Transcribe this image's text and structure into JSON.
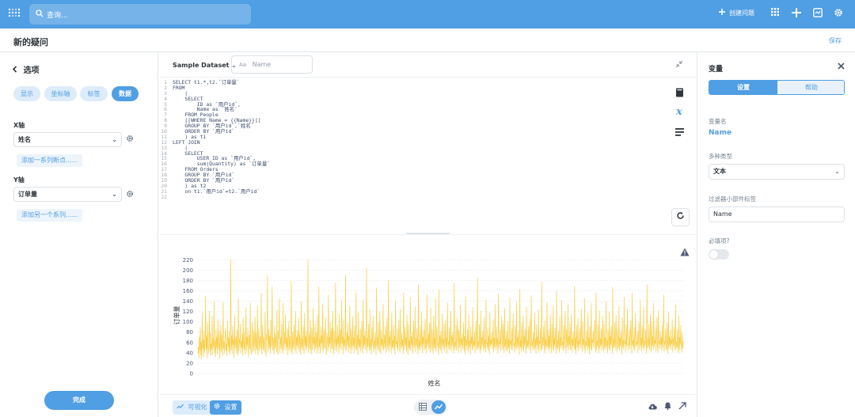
{
  "topbar": {
    "search_placeholder": "查询...",
    "new_question_label": "创建问题"
  },
  "header": {
    "title": "新的疑问",
    "save_label": "保存"
  },
  "left_panel": {
    "back_label": "选项",
    "tabs": [
      {
        "label": "显示",
        "active": false
      },
      {
        "label": "坐标轴",
        "active": false
      },
      {
        "label": "标签",
        "active": false
      },
      {
        "label": "数据",
        "active": true
      }
    ],
    "x_axis": {
      "label": "X轴",
      "value": "姓名",
      "add_link": "添加一系列断点......"
    },
    "y_axis": {
      "label": "Y轴",
      "value": "订单量",
      "add_link": "添加另一个系列......"
    },
    "done_label": "完成"
  },
  "editor": {
    "dataset_label": "Sample Dataset",
    "variable_placeholder": "Name",
    "code_lines": [
      "SELECT t1.*,t2.`订单量`",
      "FROM",
      "    (",
      "    SELECT",
      "        ID as `用户id`,",
      "        Name as `姓名`",
      "    FROM People",
      "    [[WHERE Name = {{Name}}]]",
      "    GROUP BY `用户id`,`姓名`",
      "    ORDER BY `用户id`",
      "    ) as t1",
      "LEFT JOIN",
      "    (",
      "    SELECT",
      "        USER_ID as `用户id`,",
      "        sum(Quantity) as `订单量`",
      "    FROM Orders",
      "    GROUP BY `用户id`",
      "    ORDER BY `用户id`",
      "    ) as t2",
      "    on t1.`用户id`=t2.`用户id`",
      ""
    ]
  },
  "bottom_bar": {
    "visualize_label": "可视化",
    "settings_label": "设置"
  },
  "right_panel": {
    "title": "变量",
    "tab_settings": "设置",
    "tab_help": "帮助",
    "var_name_label": "变量名",
    "var_name_value": "Name",
    "var_type_label": "多种类型",
    "var_type_value": "文本",
    "widget_label_label": "过滤器小部件标签",
    "widget_label_value": "Name",
    "required_label": "必填项?"
  },
  "chart_data": {
    "type": "line",
    "xlabel": "姓名",
    "ylabel": "订单量",
    "yticks": [
      0,
      20,
      40,
      60,
      80,
      100,
      120,
      140,
      160,
      180,
      200,
      220
    ],
    "ylim": [
      0,
      225
    ],
    "color": "#f9cf48",
    "series": [
      {
        "values": [
          38,
          52,
          29,
          71,
          44,
          90,
          35,
          61,
          27,
          118,
          48,
          66,
          32,
          84,
          41,
          57,
          150,
          46,
          73,
          30,
          99,
          55,
          38,
          64,
          121,
          43,
          79,
          34,
          58,
          47,
          112,
          36,
          68,
          52,
          141,
          40,
          63,
          31,
          87,
          49,
          71,
          37,
          105,
          58,
          45,
          83,
          29,
          60,
          94,
          42,
          76,
          51,
          35,
          138,
          47,
          62,
          39,
          70,
          88,
          44,
          57,
          33,
          101,
          53,
          69,
          41,
          82,
          36,
          61,
          221,
          45,
          74,
          38,
          92,
          55,
          66,
          30,
          113,
          48,
          59,
          72,
          40,
          85,
          51,
          34,
          145,
          43,
          67,
          58,
          96,
          39,
          62,
          49,
          77,
          35,
          108,
          54,
          46,
          81,
          37,
          64,
          128,
          42,
          71,
          53,
          89,
          31,
          60,
          75,
          47,
          137,
          50,
          36,
          68,
          99,
          41,
          57,
          84,
          44,
          63,
          110,
          38,
          79,
          52,
          46,
          131,
          35,
          67,
          88,
          43,
          59,
          72,
          48,
          156,
          37,
          61,
          94,
          45,
          70,
          53,
          41,
          119,
          56,
          33,
          76,
          64,
          190,
          42,
          58,
          86,
          47,
          73,
          39,
          104,
          51,
          62,
          168,
          44,
          69,
          55,
          37,
          92,
          48,
          77,
          60,
          41,
          123,
          53,
          36,
          82,
          66,
          145,
          40,
          58,
          71,
          47,
          97,
          52,
          38,
          136,
          61,
          45,
          79,
          57,
          115,
          43,
          69,
          50,
          88,
          35,
          64,
          102,
          46,
          73,
          54,
          41,
          179,
          59,
          37,
          81,
          48,
          66,
          94,
          44,
          58,
          121,
          39,
          71,
          53,
          85,
          47,
          63,
          108,
          42,
          76,
          57,
          36,
          140,
          50,
          68,
          45,
          93,
          61,
          38,
          117,
          54,
          72,
          43,
          83,
          49,
          66,
          221,
          40,
          59,
          77,
          46,
          104,
          52,
          37,
          89,
          63,
          45,
          126,
          56,
          71,
          42,
          97,
          48,
          60,
          80,
          39,
          113,
          55,
          44,
          168,
          51,
          67,
          38,
          92,
          58,
          74,
          46,
          135,
          41,
          63,
          85,
          53,
          47,
          109,
          59,
          36,
          78,
          64,
          43,
          152,
          50,
          70,
          57,
          99,
          40,
          65,
          88,
          48,
          121,
          54,
          37,
          83,
          61,
          45,
          176,
          52,
          68,
          42,
          95,
          57,
          74,
          39,
          115,
          49,
          62,
          86,
          44,
          141,
          58,
          71,
          37,
          104,
          53,
          66,
          47,
          191,
          43,
          60,
          79,
          55,
          98,
          41,
          72,
          50,
          131,
          62,
          38,
          87,
          56,
          46,
          110,
          53,
          69,
          40,
          93,
          61,
          47,
          157,
          44,
          58,
          75,
          36,
          118,
          52,
          67,
          49,
          86,
          42,
          64,
          101,
          57,
          39,
          143,
          48,
          73,
          55,
          82,
          45,
          60,
          205,
          40,
          69,
          51,
          96,
          58,
          43,
          124,
          47,
          66,
          37,
          89,
          54,
          71,
          112,
          41,
          63,
          48,
          80,
          59,
          36,
          166,
          52,
          70,
          45,
          99,
          57,
          42,
          120,
          61,
          38,
          85,
          53,
          67,
          47,
          135,
          44,
          58,
          76,
          50,
          92,
          40,
          65,
          108,
          56,
          46,
          181,
          42,
          71,
          54,
          83,
          60,
          39,
          117,
          48,
          64,
          51,
          94,
          45,
          73,
          37,
          140,
          57,
          62,
          49,
          87,
          43,
          69,
          104,
          55,
          41,
          125,
          59,
          47,
          78,
          52,
          66,
          38,
          157,
          45,
          61,
          90,
          53,
          70,
          42,
          113,
          58,
          36,
          96,
          50,
          64,
          46,
          148,
          44,
          72,
          55,
          81,
          39,
          63,
          102,
          49,
          57,
          130,
          41,
          68,
          53,
          88,
          60,
          37,
          172,
          47,
          65,
          44,
          93,
          58,
          51,
          119,
          40,
          71,
          56,
          84,
          43,
          62,
          105,
          48,
          67,
          39,
          153,
          54,
          60,
          77,
          46,
          98,
          52,
          41,
          127,
          63,
          45,
          86,
          57,
          38,
          111,
          50,
          69,
          47,
          145,
          42,
          64,
          91,
          55,
          59,
          36,
          162,
          49,
          73,
          44,
          82,
          61,
          40,
          116,
          53,
          66,
          48,
          97,
          43,
          58,
          103,
          51,
          70,
          38,
          137,
          56,
          62,
          45,
          89,
          47,
          65,
          121,
          42,
          74,
          54,
          80,
          58,
          39,
          175,
          46,
          61,
          52,
          94,
          44,
          68,
          108,
          57,
          40,
          84,
          63,
          50,
          132,
          41,
          69,
          55,
          77,
          47,
          60,
          99,
          43,
          72,
          38,
          149,
          53,
          66,
          46,
          86,
          59,
          42,
          114,
          51,
          64,
          37,
          91,
          56,
          71,
          45,
          128,
          48,
          63,
          53,
          81,
          40,
          67,
          102,
          58,
          44,
          186,
          50,
          62,
          47,
          95,
          55,
          39,
          121,
          46,
          70,
          54,
          83,
          61,
          43,
          109,
          49,
          66,
          41,
          143,
          57,
          60,
          48,
          88,
          44,
          73,
          38,
          118,
          52,
          65,
          56,
          79,
          47,
          62,
          104,
          41,
          69,
          50,
          134,
          59,
          45,
          92,
          53,
          67,
          39,
          155,
          48,
          61,
          57,
          85,
          43,
          74,
          111,
          54,
          46,
          97,
          62,
          40,
          126,
          51,
          68,
          45,
          82,
          58,
          42,
          101,
          49,
          66,
          38,
          147,
          55,
          63,
          47,
          89,
          44,
          71,
          116,
          53,
          59,
          41,
          93,
          57,
          48,
          139,
          46,
          70,
          52,
          84,
          60,
          37,
          163,
          50,
          65,
          43,
          98,
          56,
          47,
          112,
          42,
          72,
          54,
          86,
          61,
          39,
          129,
          48,
          64,
          51,
          91,
          45,
          69,
          106,
          57,
          40,
          151,
          53,
          62,
          47,
          80,
          59,
          44,
          117,
          49,
          67,
          38,
          95,
          55,
          71,
          46,
          124,
          41,
          63,
          58,
          87,
          50,
          43,
          178,
          47,
          70,
          54,
          92,
          60,
          39,
          103,
          45,
          66,
          52,
          138,
          57,
          48,
          85,
          42,
          73,
          50,
          114,
          56,
          40,
          96,
          62,
          46,
          131,
          44,
          68,
          53,
          89,
          59,
          38,
          160,
          49,
          64,
          45,
          83,
          57,
          41,
          110,
          52,
          70,
          47,
          142,
          55,
          61,
          43,
          93,
          48,
          67,
          121,
          58,
          39,
          86,
          63,
          50,
          134,
          44,
          72,
          54,
          98,
          46,
          60,
          115,
          41,
          66,
          53,
          81,
          57,
          47,
          169,
          45,
          69,
          38,
          94,
          61,
          50,
          107,
          43,
          64,
          56,
          88,
          48,
          71,
          125,
          59,
          42,
          100,
          55,
          67,
          46,
          145,
          40,
          62,
          53,
          84,
          58,
          44,
          118,
          51,
          69,
          37,
          91,
          57,
          47,
          136,
          43,
          65,
          60,
          82,
          49,
          72,
          104,
          55,
          41,
          157,
          46,
          63,
          52,
          95,
          59,
          39,
          122,
          48,
          68,
          54,
          87,
          44,
          61,
          111,
          57,
          42,
          97,
          50,
          70,
          46,
          140,
          53,
          64,
          40,
          85,
          58,
          47,
          120,
          43,
          72,
          55,
          92,
          61,
          38,
          167,
          49,
          66,
          51,
          99,
          45,
          62,
          113,
          56,
          42,
          88,
          59,
          48,
          131,
          44,
          69,
          53,
          81,
          60,
          37,
          108,
          50,
          65,
          46,
          148,
          57,
          63,
          41,
          94,
          52,
          71,
          126,
          45,
          58,
          55,
          86,
          47,
          67,
          103,
          60,
          39,
          156,
          54,
          64,
          48,
          90,
          43,
          70,
          117,
          51,
          61,
          56,
          83,
          40,
          66,
          99,
          58,
          46,
          143,
          53,
          69,
          42,
          92,
          57,
          49,
          128,
          44,
          63,
          55,
          85,
          61,
          38,
          172,
          48,
          68,
          51,
          96,
          46,
          60,
          114,
          59,
          41,
          101,
          54,
          72,
          45,
          137,
          50,
          64,
          57,
          88,
          43,
          67,
          109,
          53,
          40,
          123,
          58,
          62,
          47,
          82,
          55,
          70,
          44,
          93,
          49,
          66,
          152,
          42,
          63,
          56,
          87,
          51,
          45,
          98,
          60,
          38,
          119,
          48,
          71,
          54,
          84,
          46,
          65,
          57,
          105,
          41,
          68,
          53,
          90,
          59,
          44,
          133,
          47,
          62,
          50,
          86,
          55,
          39,
          112,
          45,
          70,
          56,
          94,
          52,
          41,
          79,
          48,
          63
        ]
      }
    ]
  }
}
